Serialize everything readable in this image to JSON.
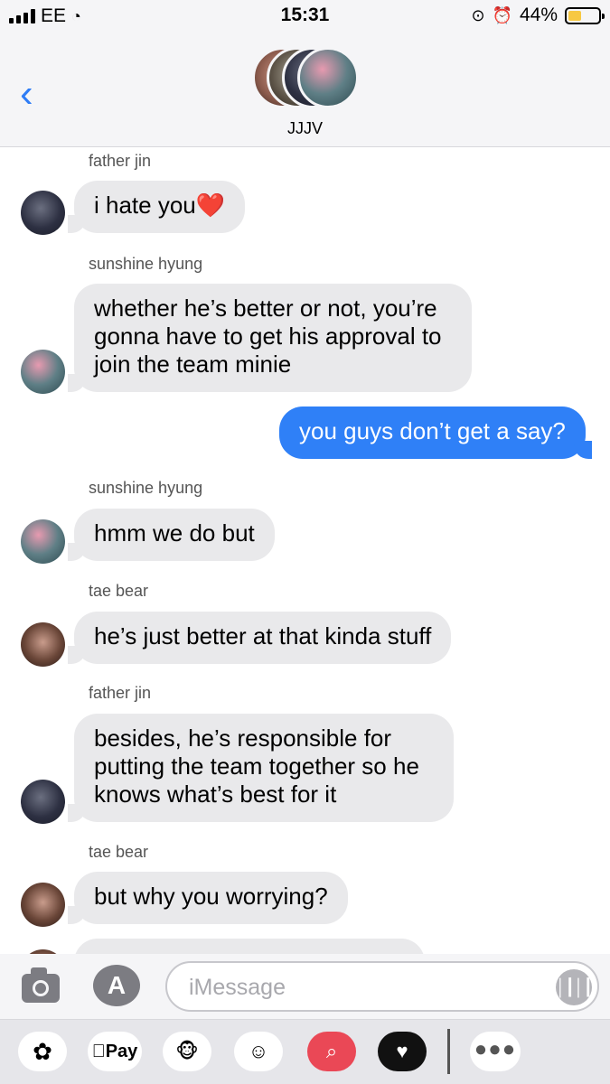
{
  "status_bar": {
    "carrier": "EE",
    "time": "15:31",
    "battery_percent": "44%",
    "battery_level": 0.44,
    "icons": [
      "signal-icon",
      "wifi-icon",
      "rotation-lock-icon",
      "alarm-icon",
      "battery-icon"
    ]
  },
  "header": {
    "back_icon": "chevron-left-icon",
    "group_name": "JJJV"
  },
  "messages": [
    {
      "sender": "father jin",
      "text": "i hate you",
      "emoji": "❤️",
      "direction": "incoming"
    },
    {
      "sender": "sunshine hyung",
      "text": "whether he’s better or not, you’re gonna have to get his approval to join the team minie",
      "direction": "incoming"
    },
    {
      "text": "you guys don’t get a say?",
      "direction": "outgoing"
    },
    {
      "sender": "sunshine hyung",
      "text": "hmm we do but",
      "direction": "incoming"
    },
    {
      "sender": "tae bear",
      "text": "he’s just better at that kinda stuff",
      "direction": "incoming"
    },
    {
      "sender": "father jin",
      "text": "besides, he’s responsible for putting the team together so he knows what’s best for it",
      "direction": "incoming"
    },
    {
      "sender": "tae bear",
      "text": "but why you worrying?",
      "direction": "incoming"
    }
  ],
  "composer": {
    "placeholder": "iMessage",
    "camera_icon": "camera-icon",
    "appstore_icon": "app-store-icon",
    "audio_icon": "audio-waveform-icon"
  },
  "app_drawer": {
    "apple_pay_label": "Pay",
    "apps": [
      "photos-icon",
      "apple-pay-icon",
      "monkey-animoji-icon",
      "memoji-icon",
      "image-search-icon",
      "digital-touch-icon",
      "more-icon"
    ]
  },
  "colors": {
    "outgoing_bubble": "#2f80f7",
    "incoming_bubble": "#e9e9eb",
    "accent": "#2f7df6"
  }
}
